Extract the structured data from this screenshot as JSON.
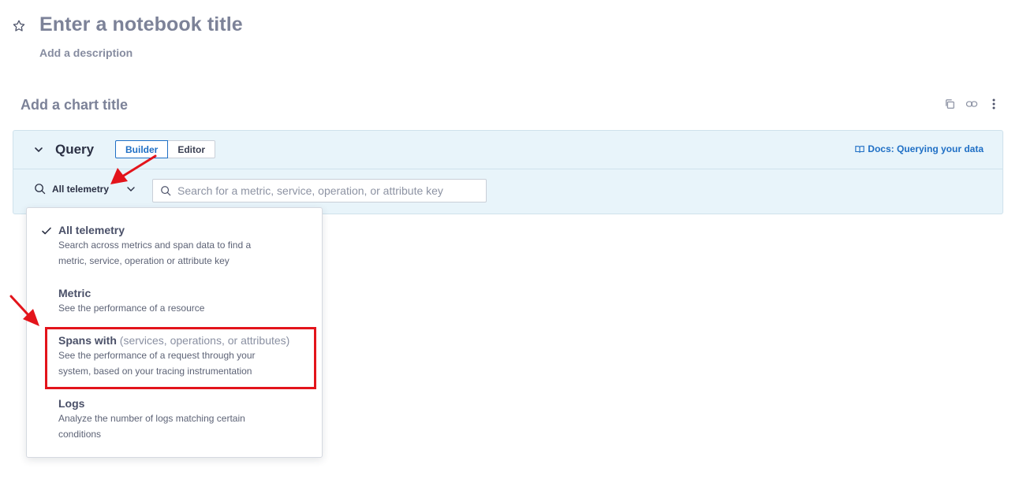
{
  "notebook": {
    "title": "Enter a notebook title",
    "description": "Add a description"
  },
  "chart": {
    "title": "Add a chart title",
    "actions": [
      "copy-icon",
      "link-icon",
      "more-vertical-icon"
    ]
  },
  "query": {
    "label": "Query",
    "modes": [
      {
        "label": "Builder",
        "active": true
      },
      {
        "label": "Editor",
        "active": false
      }
    ],
    "docs_link": "Docs: Querying your data",
    "telemetry_selected": "All telemetry",
    "search_placeholder": "Search for a metric, service, operation, or attribute key"
  },
  "dropdown": {
    "options": [
      {
        "title": "All telemetry",
        "subtitle": "",
        "desc1": "Search across metrics and span data to find a",
        "desc2": "metric, service, operation or attribute key",
        "selected": true
      },
      {
        "title": "Metric",
        "subtitle": "",
        "desc1": "See the performance of a resource",
        "desc2": "",
        "selected": false
      },
      {
        "title": "Spans with",
        "subtitle": "(services, operations, or attributes)",
        "desc1": "See the performance of a request through your",
        "desc2": "system, based on your tracing instrumentation",
        "selected": false
      },
      {
        "title": "Logs",
        "subtitle": "",
        "desc1": "Analyze the number of logs matching certain",
        "desc2": "conditions",
        "selected": false
      }
    ]
  },
  "colors": {
    "accent": "#1f6fc5",
    "panel_bg": "#e8f4fa",
    "annotation_red": "#e3141b"
  }
}
